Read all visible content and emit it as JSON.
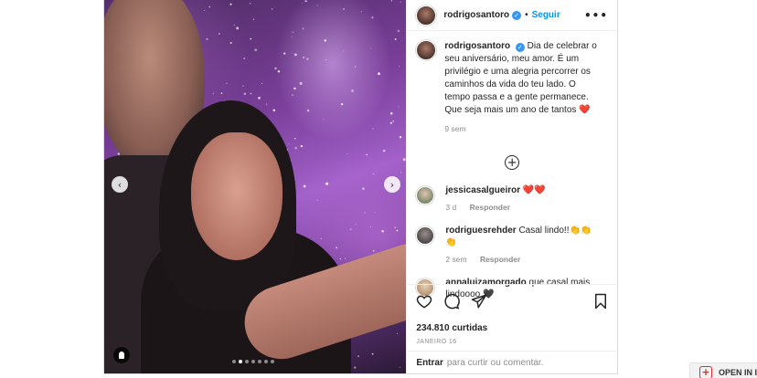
{
  "post": {
    "author": {
      "username": "rodrigosantoro",
      "verified_icon": "verified-check-icon",
      "separator": "•",
      "follow_label": "Seguir",
      "more_icon": "more-options-icon",
      "more_glyph": "•••"
    },
    "caption": {
      "username": "rodrigosantoro",
      "text": "Dia de celebrar o seu aniversário, meu amor. É um privilégio e uma alegria percorrer os caminhos da vida do teu lado. O tempo passa e a gente permanece. Que seja mais um ano de tantos",
      "emoji": "❤️",
      "age": "9 sem"
    },
    "load_more_icon": "plus-circle-icon",
    "load_more_glyph": "+",
    "comments": [
      {
        "username": "jessicasalgueiror",
        "text": "❤️❤️",
        "age": "3 d",
        "reply_label": "Responder"
      },
      {
        "username": "rodriguesrehder",
        "text": "Casal lindo!!👏👏👏",
        "age": "2 sem",
        "reply_label": "Responder"
      },
      {
        "username": "annaluizamorgado",
        "text": "que casal mais lindoooo 🖤",
        "age": "",
        "reply_label": ""
      }
    ],
    "actions": {
      "like_icon": "heart-icon",
      "comment_icon": "comment-icon",
      "share_icon": "paper-plane-icon",
      "save_icon": "bookmark-icon"
    },
    "likes": "234.810 curtidas",
    "date": "JANEIRO 16",
    "add_comment": {
      "enter_label": "Entrar",
      "rest_text": "para curtir ou comentar."
    },
    "carousel": {
      "prev_glyph": "‹",
      "next_glyph": "›",
      "slide_count": 7,
      "active_index": 1
    }
  },
  "badge": {
    "plus_glyph": "+",
    "label": "OPEN IN I"
  },
  "colors": {
    "link_blue": "#0095f6",
    "verified_blue": "#3897f0",
    "heart_red": "#ed4956",
    "meta_gray": "#8e8e8e"
  }
}
